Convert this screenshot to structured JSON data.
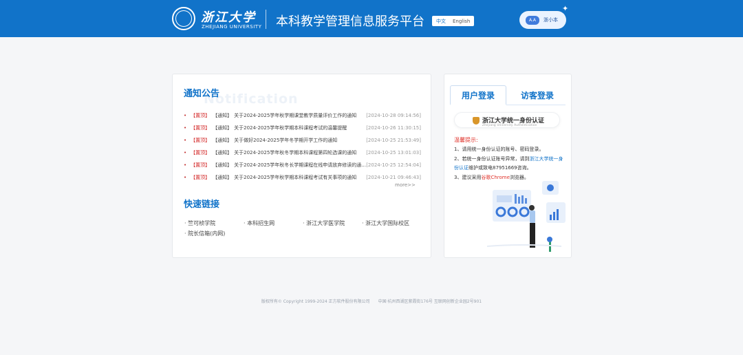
{
  "header": {
    "univ_cn": "浙江大学",
    "univ_en": "ZHEJIANG UNIVERSITY",
    "platform_title": "本科教学管理信息服务平台",
    "lang_cn": "中文",
    "lang_en": "English",
    "assistant_avatar": "A.A",
    "assistant_label": "浙小本"
  },
  "notice": {
    "title": "通知公告",
    "title_watermark": "Notification",
    "items": [
      {
        "pin": "【置顶】",
        "tag": "【通知】",
        "title": "关于2024-2025学年秋学期课堂教学质量评价工作的通知",
        "date": "[2024-10-28 09:14:56]"
      },
      {
        "pin": "【置顶】",
        "tag": "【通知】",
        "title": "关于2024-2025学年秋学期本科课程考试的温馨提醒",
        "date": "[2024-10-26 11:30:15]"
      },
      {
        "pin": "【置顶】",
        "tag": "【通知】",
        "title": "关于做好2024-2025学年冬学期开学工作的通知",
        "date": "[2024-10-25 21:53:49]"
      },
      {
        "pin": "【置顶】",
        "tag": "【通知】",
        "title": "关于2024-2025学年秋冬学期本科课程第四轮选课的通知",
        "date": "[2024-10-25 13:01:03]"
      },
      {
        "pin": "【置顶】",
        "tag": "【通知】",
        "title": "关于2024-2025学年秋冬长学期课程在线申请放弃修读的通...",
        "date": "[2024-10-25 12:54:04]"
      },
      {
        "pin": "【置顶】",
        "tag": "【通知】",
        "title": "关于2024-2025学年秋学期本科课程考试有关事项的通知",
        "date": "[2024-10-21 09:46:43]"
      }
    ],
    "more": "more>>"
  },
  "quick_links": {
    "title": "快速链接",
    "items": [
      "竺可桢学院",
      "本科招生网",
      "浙江大学医学院",
      "浙江大学国际校区",
      "院长信箱(内网)"
    ]
  },
  "login": {
    "tab_user": "用户登录",
    "tab_guest": "访客登录",
    "sso_label": "浙江大学统一身份认证",
    "sso_sub": "Zhejiang University Authentication",
    "tips_title": "温馨提示:",
    "tip1": "1、请用统一身份认证的账号、密码登录。",
    "tip2_a": "2、若统一身份认证账号异常，请到",
    "tip2_link": "浙江大学统一身份认证",
    "tip2_b": "维护或致电",
    "tip2_phone": "87951669",
    "tip2_c": "咨询。",
    "tip3_a": "3、建议采用",
    "tip3_browser": "谷歌Chrome",
    "tip3_b": "浏览器。"
  },
  "footer": {
    "copyright": "版权所有© Copyright 1999-2024 正方软件股份有限公司",
    "address": "中国·杭州西湖区紫霞街176号 互联网创新企业园2号901"
  },
  "colors": {
    "brand": "#1173c9",
    "pin_red": "#d11f1f"
  }
}
